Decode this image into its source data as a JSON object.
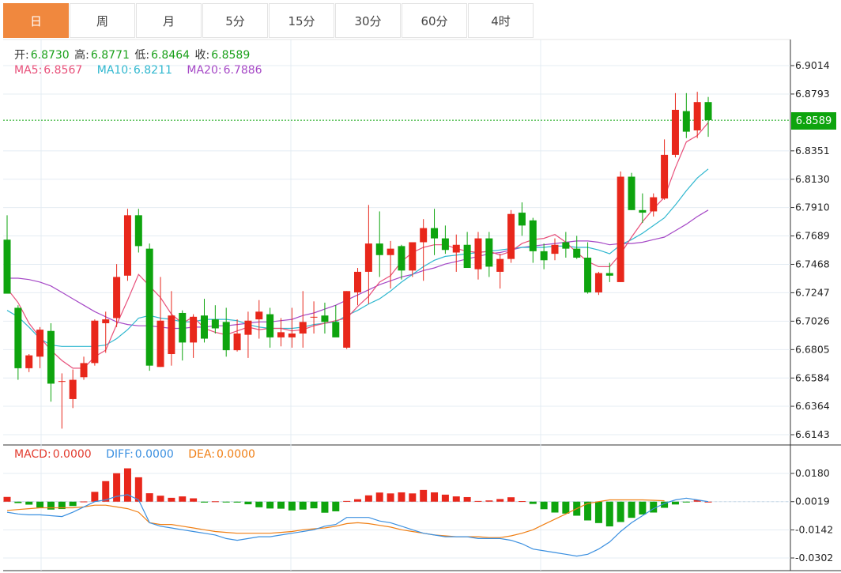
{
  "tabs": [
    {
      "label": "日",
      "active": true
    },
    {
      "label": "周",
      "active": false
    },
    {
      "label": "月",
      "active": false
    },
    {
      "label": "5分",
      "active": false
    },
    {
      "label": "15分",
      "active": false
    },
    {
      "label": "30分",
      "active": false
    },
    {
      "label": "60分",
      "active": false
    },
    {
      "label": "4时",
      "active": false
    }
  ],
  "ohlc": {
    "open_label": "开:",
    "open": "6.8730",
    "high_label": "高:",
    "high": "6.8771",
    "low_label": "低:",
    "low": "6.8464",
    "close_label": "收:",
    "close": "6.8589"
  },
  "ma": {
    "ma5_label": "MA5:",
    "ma5": "6.8567",
    "ma10_label": "MA10:",
    "ma10": "6.8211",
    "ma20_label": "MA20:",
    "ma20": "6.7886"
  },
  "macd": {
    "macd_label": "MACD:",
    "macd": "0.0000",
    "diff_label": "DIFF:",
    "diff": "0.0000",
    "dea_label": "DEA:",
    "dea": "0.0000"
  },
  "current_price": "6.8589",
  "colors": {
    "up": "#e8271b",
    "down": "#0ea40e",
    "ma5": "#e8507a",
    "ma10": "#2fb7cf",
    "ma20": "#a548c6",
    "diff": "#3a8fe0",
    "dea": "#f07f14"
  },
  "chart_data": {
    "type": "candlestick",
    "price_axis": {
      "ticks": [
        "6.9014",
        "6.8793",
        "6.8351",
        "6.8130",
        "6.7910",
        "6.7689",
        "6.7468",
        "6.7247",
        "6.7026",
        "6.6805",
        "6.6584",
        "6.6364",
        "6.6143"
      ],
      "range": [
        6.6143,
        6.9014
      ]
    },
    "macd_axis": {
      "ticks": [
        "0.0180",
        "0.0019",
        "-0.0142",
        "-0.0302"
      ],
      "range": [
        -0.0302,
        0.018
      ]
    },
    "candles": [
      [
        6.766,
        6.785,
        6.725,
        6.724
      ],
      [
        6.713,
        6.715,
        6.657,
        6.666
      ],
      [
        6.666,
        6.677,
        6.663,
        6.676
      ],
      [
        6.675,
        6.698,
        6.666,
        6.696
      ],
      [
        6.695,
        6.701,
        6.64,
        6.654
      ],
      [
        6.656,
        6.662,
        6.619,
        6.656
      ],
      [
        6.642,
        6.665,
        6.635,
        6.657
      ],
      [
        6.659,
        6.675,
        6.657,
        6.67
      ],
      [
        6.67,
        6.704,
        6.668,
        6.703
      ],
      [
        6.701,
        6.71,
        6.678,
        6.704
      ],
      [
        6.705,
        6.747,
        6.698,
        6.737
      ],
      [
        6.738,
        6.79,
        6.734,
        6.785
      ],
      [
        6.785,
        6.79,
        6.756,
        6.761
      ],
      [
        6.759,
        6.763,
        6.664,
        6.668
      ],
      [
        6.667,
        6.737,
        6.667,
        6.703
      ],
      [
        6.677,
        6.726,
        6.668,
        6.707
      ],
      [
        6.709,
        6.711,
        6.672,
        6.686
      ],
      [
        6.686,
        6.708,
        6.674,
        6.706
      ],
      [
        6.707,
        6.72,
        6.686,
        6.689
      ],
      [
        6.704,
        6.715,
        6.693,
        6.697
      ],
      [
        6.702,
        6.713,
        6.675,
        6.68
      ],
      [
        6.68,
        6.704,
        6.679,
        6.693
      ],
      [
        6.692,
        6.71,
        6.674,
        6.703
      ],
      [
        6.704,
        6.719,
        6.689,
        6.71
      ],
      [
        6.708,
        6.713,
        6.682,
        6.69
      ],
      [
        6.69,
        6.705,
        6.683,
        6.694
      ],
      [
        6.69,
        6.713,
        6.682,
        6.693
      ],
      [
        6.693,
        6.726,
        6.682,
        6.702
      ],
      [
        6.706,
        6.718,
        6.693,
        6.706
      ],
      [
        6.707,
        6.717,
        6.693,
        6.702
      ],
      [
        6.702,
        6.715,
        6.691,
        6.69
      ],
      [
        6.682,
        6.726,
        6.681,
        6.726
      ],
      [
        6.725,
        6.744,
        6.715,
        6.741
      ],
      [
        6.741,
        6.793,
        6.716,
        6.763
      ],
      [
        6.763,
        6.788,
        6.737,
        6.754
      ],
      [
        6.754,
        6.765,
        6.728,
        6.759
      ],
      [
        6.761,
        6.762,
        6.735,
        6.742
      ],
      [
        6.742,
        6.759,
        6.737,
        6.764
      ],
      [
        6.764,
        6.782,
        6.734,
        6.775
      ],
      [
        6.775,
        6.79,
        6.754,
        6.767
      ],
      [
        6.767,
        6.777,
        6.755,
        6.758
      ],
      [
        6.756,
        6.77,
        6.741,
        6.762
      ],
      [
        6.762,
        6.772,
        6.747,
        6.744
      ],
      [
        6.743,
        6.772,
        6.735,
        6.767
      ],
      [
        6.767,
        6.772,
        6.737,
        6.745
      ],
      [
        6.741,
        6.755,
        6.728,
        6.751
      ],
      [
        6.751,
        6.789,
        6.748,
        6.786
      ],
      [
        6.787,
        6.795,
        6.769,
        6.777
      ],
      [
        6.781,
        6.783,
        6.748,
        6.757
      ],
      [
        6.757,
        6.763,
        6.743,
        6.75
      ],
      [
        6.755,
        6.767,
        6.75,
        6.762
      ],
      [
        6.764,
        6.772,
        6.752,
        6.759
      ],
      [
        6.759,
        6.769,
        6.751,
        6.752
      ],
      [
        6.752,
        6.764,
        6.724,
        6.725
      ],
      [
        6.725,
        6.741,
        6.723,
        6.74
      ],
      [
        6.74,
        6.748,
        6.733,
        6.738
      ],
      [
        6.733,
        6.819,
        6.733,
        6.815
      ],
      [
        6.815,
        6.818,
        6.789,
        6.789
      ],
      [
        6.789,
        6.802,
        6.779,
        6.787
      ],
      [
        6.788,
        6.802,
        6.784,
        6.799
      ],
      [
        6.798,
        6.844,
        6.797,
        6.832
      ],
      [
        6.832,
        6.88,
        6.83,
        6.867
      ],
      [
        6.866,
        6.88,
        6.845,
        6.85
      ],
      [
        6.851,
        6.881,
        6.845,
        6.873
      ],
      [
        6.873,
        6.877,
        6.846,
        6.859
      ]
    ],
    "ma5": [
      6.728,
      6.717,
      6.701,
      6.69,
      6.68,
      6.672,
      6.666,
      6.666,
      6.675,
      6.68,
      6.7,
      6.719,
      6.739,
      6.73,
      6.721,
      6.708,
      6.701,
      6.706,
      6.697,
      6.694,
      6.692,
      6.695,
      6.698,
      6.696,
      6.697,
      6.697,
      6.695,
      6.696,
      6.699,
      6.701,
      6.703,
      6.705,
      6.714,
      6.722,
      6.733,
      6.738,
      6.749,
      6.756,
      6.76,
      6.762,
      6.762,
      6.759,
      6.757,
      6.756,
      6.757,
      6.754,
      6.757,
      6.763,
      6.766,
      6.767,
      6.77,
      6.764,
      6.756,
      6.749,
      6.745,
      6.745,
      6.755,
      6.768,
      6.78,
      6.79,
      6.799,
      6.822,
      6.842,
      6.847,
      6.857
    ],
    "ma10": [
      6.711,
      6.706,
      6.698,
      6.689,
      6.684,
      6.683,
      6.683,
      6.683,
      6.683,
      6.684,
      6.689,
      6.696,
      6.705,
      6.707,
      6.705,
      6.704,
      6.702,
      6.702,
      6.704,
      6.704,
      6.704,
      6.703,
      6.7,
      6.698,
      6.697,
      6.697,
      6.697,
      6.698,
      6.7,
      6.701,
      6.702,
      6.707,
      6.711,
      6.716,
      6.72,
      6.726,
      6.733,
      6.739,
      6.745,
      6.75,
      6.753,
      6.754,
      6.755,
      6.756,
      6.757,
      6.758,
      6.759,
      6.76,
      6.76,
      6.76,
      6.761,
      6.761,
      6.76,
      6.76,
      6.758,
      6.755,
      6.762,
      6.766,
      6.771,
      6.777,
      6.783,
      6.793,
      6.804,
      6.814,
      6.821
    ],
    "ma20": [
      6.736,
      6.736,
      6.735,
      6.733,
      6.73,
      6.725,
      6.72,
      6.715,
      6.71,
      6.706,
      6.702,
      6.7,
      6.699,
      6.699,
      6.698,
      6.697,
      6.697,
      6.698,
      6.698,
      6.699,
      6.699,
      6.7,
      6.701,
      6.702,
      6.702,
      6.703,
      6.704,
      6.707,
      6.709,
      6.712,
      6.715,
      6.719,
      6.723,
      6.727,
      6.731,
      6.734,
      6.737,
      6.739,
      6.742,
      6.744,
      6.747,
      6.749,
      6.751,
      6.753,
      6.755,
      6.756,
      6.758,
      6.76,
      6.761,
      6.762,
      6.763,
      6.764,
      6.765,
      6.765,
      6.764,
      6.762,
      6.763,
      6.763,
      6.764,
      6.766,
      6.768,
      6.773,
      6.778,
      6.784,
      6.789
    ],
    "macd_hist": [
      0.0027,
      -0.0008,
      -0.0017,
      -0.0034,
      -0.0045,
      -0.0042,
      -0.0025,
      0.0001,
      0.0056,
      0.0117,
      0.0162,
      0.019,
      0.0139,
      0.0048,
      0.0034,
      0.0022,
      0.003,
      0.0019,
      -0.0005,
      0.0002,
      -0.0003,
      -0.0005,
      -0.0015,
      -0.0032,
      -0.0039,
      -0.004,
      -0.005,
      -0.0045,
      -0.0038,
      -0.0063,
      -0.0055,
      0.0004,
      0.0014,
      0.0036,
      0.0052,
      0.0047,
      0.0053,
      0.0047,
      0.0067,
      0.0053,
      0.004,
      0.003,
      0.0026,
      0.0004,
      0.0007,
      0.0015,
      0.0025,
      0.0003,
      -0.0013,
      -0.0043,
      -0.0062,
      -0.0068,
      -0.008,
      -0.0107,
      -0.0122,
      -0.0141,
      -0.0116,
      -0.0092,
      -0.0073,
      -0.0062,
      -0.0035,
      -0.0016,
      -0.0002,
      0.0009,
      0.0
    ],
    "diff": [
      -0.006,
      -0.007,
      -0.0075,
      -0.0075,
      -0.008,
      -0.0085,
      -0.006,
      -0.003,
      0.0,
      0.001,
      0.003,
      0.004,
      0.001,
      -0.012,
      -0.014,
      -0.015,
      -0.016,
      -0.017,
      -0.018,
      -0.019,
      -0.021,
      -0.022,
      -0.021,
      -0.02,
      -0.02,
      -0.019,
      -0.018,
      -0.017,
      -0.016,
      -0.014,
      -0.013,
      -0.009,
      -0.009,
      -0.009,
      -0.011,
      -0.012,
      -0.014,
      -0.016,
      -0.018,
      -0.019,
      -0.02,
      -0.02,
      -0.02,
      -0.021,
      -0.021,
      -0.021,
      -0.022,
      -0.024,
      -0.027,
      -0.028,
      -0.029,
      -0.03,
      -0.031,
      -0.03,
      -0.027,
      -0.023,
      -0.017,
      -0.012,
      -0.008,
      -0.004,
      -0.001,
      0.001,
      0.002,
      0.001,
      0.0
    ],
    "dea": [
      -0.005,
      -0.0045,
      -0.004,
      -0.0035,
      -0.0035,
      -0.0035,
      -0.0035,
      -0.003,
      -0.002,
      -0.002,
      -0.003,
      -0.004,
      -0.006,
      -0.012,
      -0.013,
      -0.013,
      -0.014,
      -0.015,
      -0.016,
      -0.017,
      -0.0175,
      -0.018,
      -0.018,
      -0.018,
      -0.018,
      -0.0175,
      -0.017,
      -0.016,
      -0.0155,
      -0.015,
      -0.014,
      -0.0125,
      -0.012,
      -0.0125,
      -0.0135,
      -0.0145,
      -0.016,
      -0.017,
      -0.018,
      -0.019,
      -0.0195,
      -0.02,
      -0.02,
      -0.02,
      -0.0205,
      -0.0205,
      -0.0195,
      -0.018,
      -0.016,
      -0.013,
      -0.01,
      -0.007,
      -0.004,
      -0.001,
      0.0,
      0.001,
      0.001,
      0.001,
      0.001,
      0.0008,
      0.0005
    ]
  }
}
